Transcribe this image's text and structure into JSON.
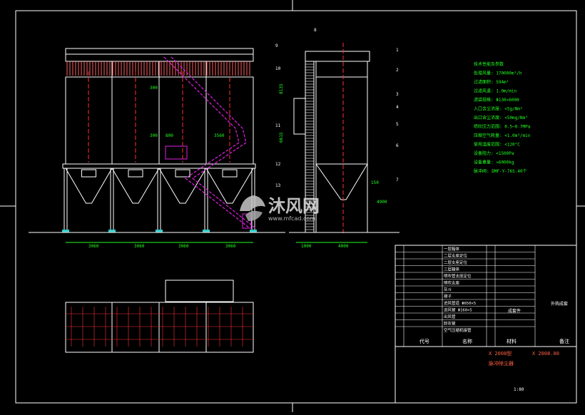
{
  "title_block": {
    "drawing_no": "X 2008.00",
    "model": "X 2008型",
    "product_name": "脉冲除尘器",
    "scale": "1:80",
    "header_code": "代号",
    "header_name": "名称",
    "header_qty": "数量",
    "header_material": "材料",
    "header_weight_single": "单件",
    "header_weight_total": "总计",
    "header_weight": "重量",
    "header_remark": "备注",
    "note_right": "外购成套",
    "note_mid": "成套件"
  },
  "bom_items": [
    {
      "name": "一层箱体"
    },
    {
      "name": "二层支座定位"
    },
    {
      "name": "二层支座定位"
    },
    {
      "name": "三层箱体"
    },
    {
      "name": "喷吹管支座定位"
    },
    {
      "name": "喷吹支座"
    },
    {
      "name": "灰斗"
    },
    {
      "name": "梯子"
    },
    {
      "name": "进风管道 Φ650×5"
    },
    {
      "name": "进风管 Φ160×5"
    },
    {
      "name": "出风管"
    },
    {
      "name": "卸灰管"
    },
    {
      "name": "空气压缩机接管"
    }
  ],
  "specs": [
    "技术性能及参数",
    "处理风量: 170000m³/h",
    "过滤面积: 594m²",
    "过滤风速: 1.0m/min",
    "滤袋规格: Φ130×6000",
    "入口含尘浓度: <5g/Nm³",
    "出口含尘浓度: <50mg/Nm³",
    "喷吹压力范围: 0.5~0.7MPa",
    "压缩空气耗量: <1.0m³/min",
    "使用温度范围: <120°C",
    "设备阻力: <1500Pa",
    "设备重量: ≈6000kg",
    "脉冲阀: DMF-Y-76S.40个"
  ],
  "dimensions": {
    "width_1": "3060",
    "width_2": "3060",
    "width_3": "3060",
    "width_4": "3060",
    "side_w1": "1000",
    "side_w2": "4000",
    "dim_300": "300",
    "dim_300b": "300",
    "dim_800": "800",
    "dim_3560": "3560",
    "dim_150": "150",
    "dim_4900": "4900",
    "dim_v1": "8135",
    "dim_v2": "6615"
  },
  "callouts": [
    "8",
    "9",
    "10",
    "11",
    "12",
    "13",
    "1",
    "2",
    "3",
    "4",
    "5",
    "6",
    "7"
  ],
  "watermark": {
    "text": "沐风网",
    "url": "www.mfcad.com"
  },
  "colors": {
    "frame": "#ffffff",
    "structure": "#ffffff",
    "centerline": "#ff3030",
    "ladder": "#e020e0",
    "dimension": "#20ff20",
    "spec_text": "#20ff20",
    "tube": "#ff6060",
    "plate": "#ffffff",
    "watermark": "#d0d0d0"
  }
}
